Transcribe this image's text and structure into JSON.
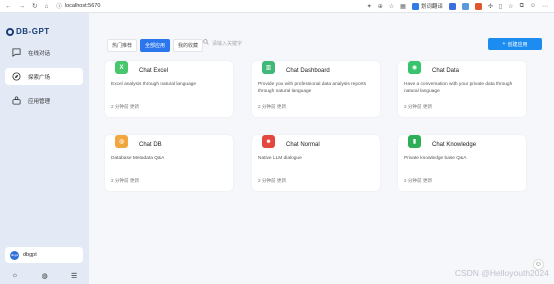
{
  "browser": {
    "url": "localhost:5670",
    "translate_label": "划词翻译"
  },
  "sidebar": {
    "logo_text": "DB-GPT",
    "items": [
      {
        "label": "在线对话",
        "icon": "chat-icon"
      },
      {
        "label": "探索广场",
        "icon": "explore-icon"
      },
      {
        "label": "应用管理",
        "icon": "app-manage-icon"
      }
    ],
    "user": {
      "name": "dbgpt",
      "avatar_text": "dbgpt"
    }
  },
  "main": {
    "tabs": [
      "热门推荐",
      "全部应用",
      "我的收藏"
    ],
    "active_tab": 1,
    "search_placeholder": "请输入关键字",
    "create_label": "创建应用",
    "cards": [
      {
        "title": "Chat Excel",
        "desc": "Excel analysis through natural language",
        "time": "2 分钟前 更新",
        "color": "#47c66b",
        "icon": "excel-icon",
        "glyph": "X"
      },
      {
        "title": "Chat Dashboard",
        "desc": "Provide you with professional data analysis reports through natural language",
        "time": "2 分钟前 更新",
        "color": "#3fb879",
        "icon": "dashboard-icon",
        "glyph": "▥"
      },
      {
        "title": "Chat Data",
        "desc": "Have a conversation with your private data through natural language",
        "time": "2 分钟前 更新",
        "color": "#37c46c",
        "icon": "data-chat-icon",
        "glyph": "◉"
      },
      {
        "title": "Chat DB",
        "desc": "Database Metadata Q&A",
        "time": "2 分钟前 更新",
        "color": "#f2a640",
        "icon": "db-icon",
        "glyph": "◍"
      },
      {
        "title": "Chat Normal",
        "desc": "Native LLM dialogue",
        "time": "2 分钟前 更新",
        "color": "#e2483d",
        "icon": "normal-chat-icon",
        "glyph": "☻"
      },
      {
        "title": "Chat Knowledge",
        "desc": "Private knowledge base Q&A",
        "time": "2 分钟前 更新",
        "color": "#2fae5a",
        "icon": "knowledge-icon",
        "glyph": "▮"
      }
    ]
  },
  "watermark": "CSDN @Helloyouth2024"
}
